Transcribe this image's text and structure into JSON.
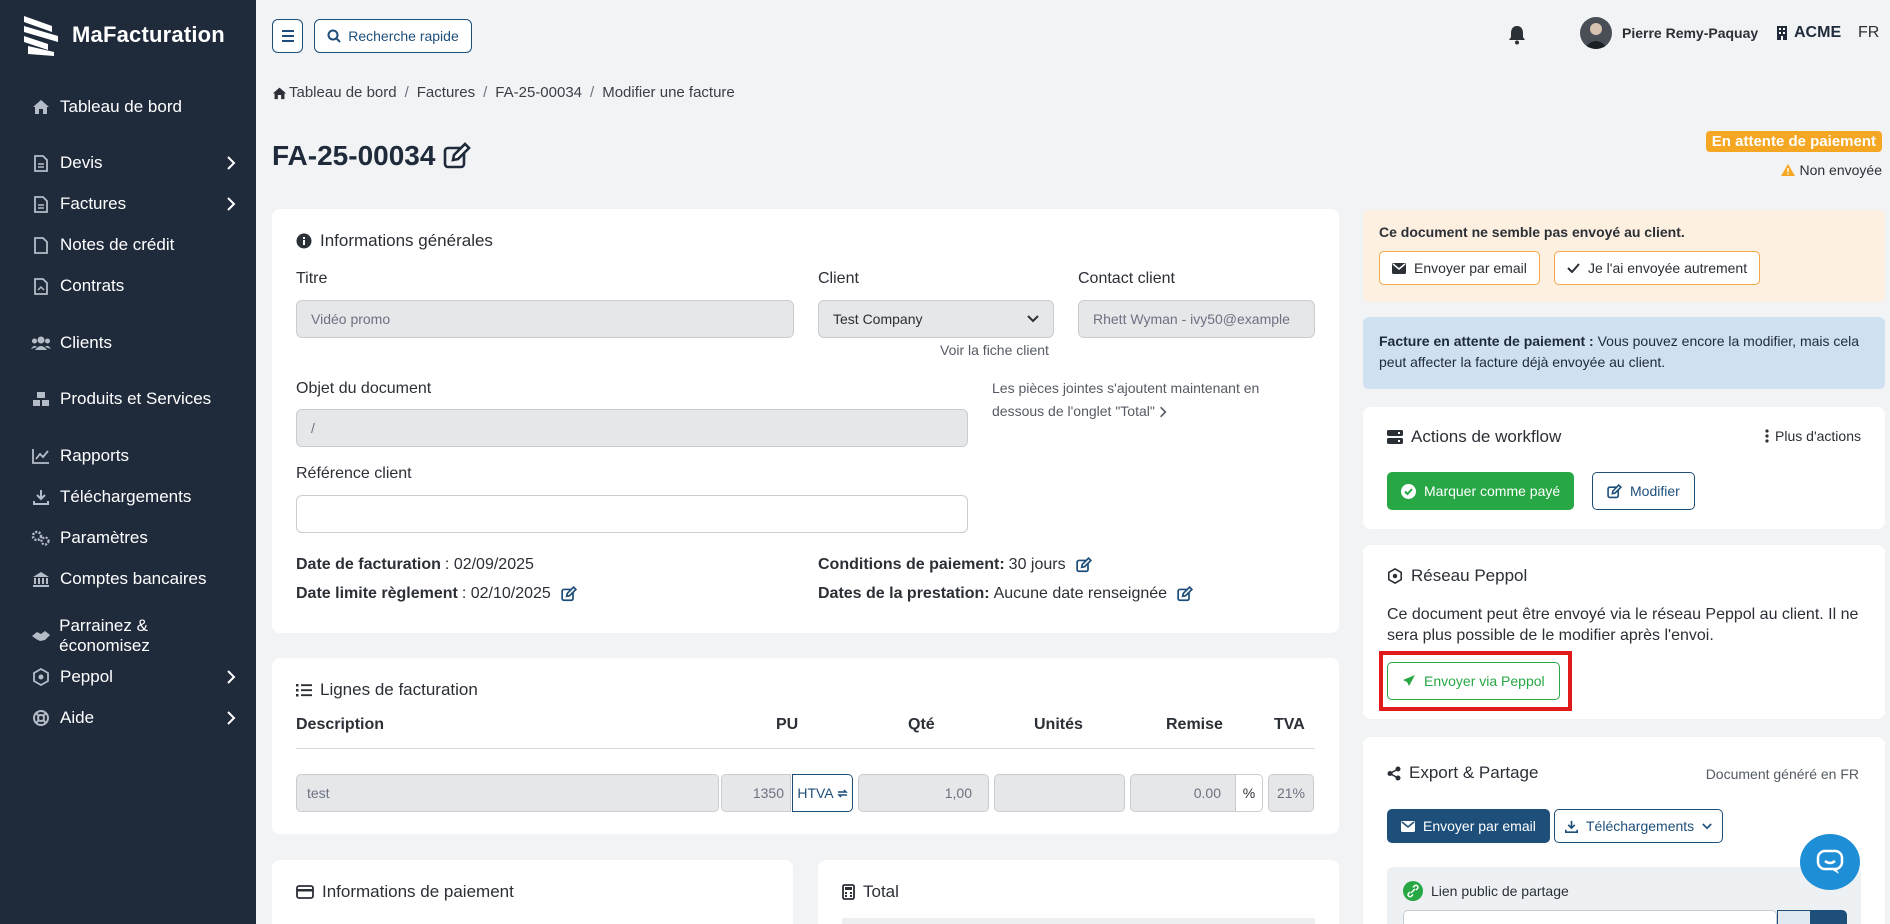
{
  "brand": {
    "name": "MaFacturation"
  },
  "sidebar": {
    "items": [
      {
        "label": "Tableau de bord"
      },
      {
        "label": "Devis"
      },
      {
        "label": "Factures"
      },
      {
        "label": "Notes de crédit"
      },
      {
        "label": "Contrats"
      },
      {
        "label": "Clients"
      },
      {
        "label": "Produits et Services"
      },
      {
        "label": "Rapports"
      },
      {
        "label": "Téléchargements"
      },
      {
        "label": "Paramètres"
      },
      {
        "label": "Comptes bancaires"
      },
      {
        "label": "Parrainez & économisez"
      },
      {
        "label": "Peppol"
      },
      {
        "label": "Aide"
      }
    ]
  },
  "header": {
    "search_label": "Recherche rapide",
    "user_name": "Pierre Remy-Paquay",
    "company": "ACME",
    "language": "FR"
  },
  "breadcrumb": {
    "items": [
      "Tableau de bord",
      "Factures",
      "FA-25-00034",
      "Modifier une facture"
    ]
  },
  "page": {
    "title": "FA-25-00034",
    "status": "En attente de paiement",
    "send_status": "Non envoyée"
  },
  "general": {
    "title": "Informations générales",
    "titre_label": "Titre",
    "titre_value": "Vidéo promo",
    "client_label": "Client",
    "client_value": "Test Company",
    "client_link": "Voir la fiche client",
    "contact_label": "Contact client",
    "contact_value": "Rhett Wyman - ivy50@example",
    "objet_label": "Objet du document",
    "objet_value": "/",
    "attachments_note": "Les pièces jointes s'ajoutent maintenant en dessous de l'onglet \"Total\"",
    "ref_label": "Référence client",
    "ref_value": "",
    "date_fact_label": "Date de facturation",
    "date_fact_value": ": 02/09/2025",
    "date_limite_label": "Date limite règlement",
    "date_limite_value": ": 02/10/2025",
    "conditions_label": "Conditions de paiement:",
    "conditions_value": "30 jours",
    "dates_presta_label": "Dates de la prestation:",
    "dates_presta_value": "Aucune date renseignée"
  },
  "lines": {
    "title": "Lignes de facturation",
    "headers": [
      "Description",
      "PU",
      "Qté",
      "Unités",
      "Remise",
      "TVA"
    ],
    "row": {
      "description": "test",
      "pu": "1350",
      "pu_mode": "HTVA",
      "qty": "1,00",
      "units": "",
      "discount": "0.00",
      "discount_unit": "%",
      "vat": "21%"
    }
  },
  "payment_info": {
    "title": "Informations de paiement"
  },
  "total": {
    "title": "Total"
  },
  "warning": {
    "text": "Ce document ne semble pas envoyé au client.",
    "email_btn": "Envoyer par email",
    "other_btn": "Je l'ai envoyée autrement"
  },
  "info": {
    "bold": "Facture en attente de paiement :",
    "text": " Vous pouvez encore la modifier, mais cela peut affecter la facture déjà envoyée au client."
  },
  "workflow": {
    "title": "Actions de workflow",
    "more": "Plus d'actions",
    "paid_btn": "Marquer comme payé",
    "edit_btn": "Modifier"
  },
  "peppol": {
    "title": "Réseau Peppol",
    "text": "Ce document peut être envoyé via le réseau Peppol au client. Il ne sera plus possible de le modifier après l'envoi.",
    "send_btn": "Envoyer via Peppol"
  },
  "export": {
    "title": "Export & Partage",
    "generated": "Document généré en FR",
    "email_btn": "Envoyer par email",
    "downloads_btn": "Téléchargements",
    "public_link_label": "Lien public de partage"
  },
  "colors": {
    "sidebar_bg": "#1f2a3b",
    "primary": "#1e4f7a",
    "success": "#28a745",
    "warning": "#f5a623",
    "highlight": "#e01a1a"
  }
}
